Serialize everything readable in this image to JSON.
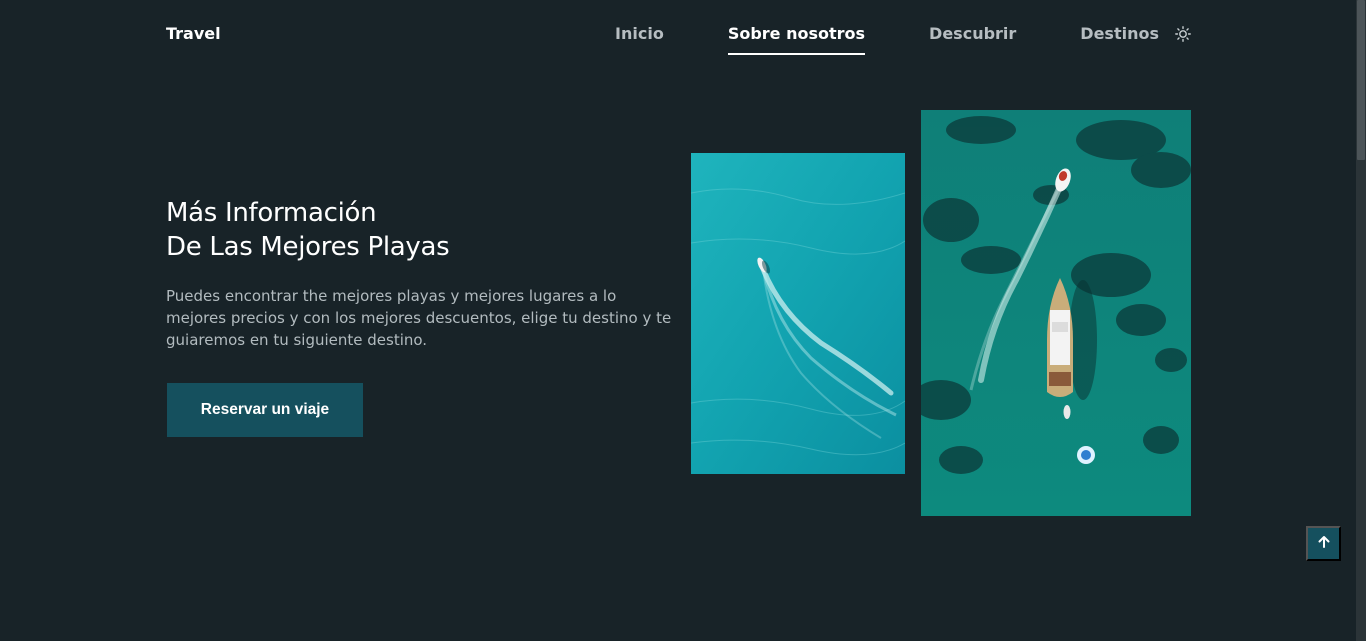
{
  "header": {
    "logo": "Travel",
    "nav": [
      {
        "label": "Inicio",
        "active": false
      },
      {
        "label": "Sobre nosotros",
        "active": true
      },
      {
        "label": "Descubrir",
        "active": false
      },
      {
        "label": "Destinos",
        "active": false
      }
    ],
    "theme_icon": "sun-icon"
  },
  "hero": {
    "title_line1": "Más Información",
    "title_line2": "De Las Mejores Playas",
    "description": "Puedes encontrar the mejores playas y mejores lugares a lo mejores precios y con los mejores descuentos, elige tu destino y te guiaremos en tu siguiente destino.",
    "cta_label": "Reservar un viaje"
  },
  "images": {
    "left": "aerial-boat-turquoise-sea",
    "right": "aerial-yacht-and-speedboat"
  },
  "scroll_top_icon": "arrow-up-icon",
  "colors": {
    "background": "#182328",
    "accent": "#15505e",
    "text": "#ffffff",
    "muted": "#b2bbbf"
  }
}
